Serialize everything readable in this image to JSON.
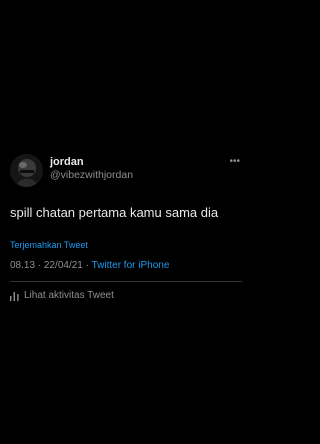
{
  "tweet": {
    "author": {
      "display_name": "jordan",
      "handle": "@vibezwithjordan",
      "avatar_icon": "profile-photo"
    },
    "more_icon": "ellipsis-icon",
    "text": "spill chatan pertama kamu sama dia",
    "translate_label": "Terjemahkan Tweet",
    "meta": {
      "time": "08.13",
      "separator": " · ",
      "date": "22/04/21",
      "client": "Twitter for iPhone"
    },
    "activity_label": "Lihat aktivitas Tweet",
    "activity_icon": "bar-chart-icon"
  },
  "colors": {
    "background": "#000000",
    "text": "#e7e9ea",
    "secondary": "#8b9196",
    "accent": "#1d9bf0"
  }
}
